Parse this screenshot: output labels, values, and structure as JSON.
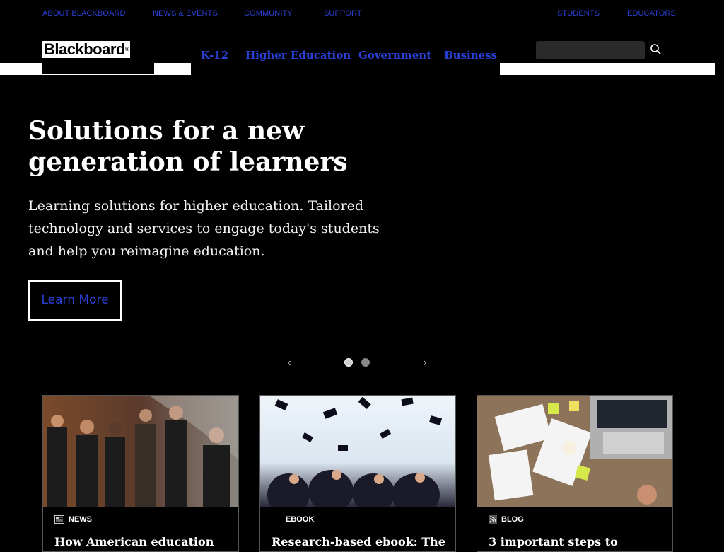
{
  "top_links": [
    {
      "label": "ABOUT BLACKBOARD"
    },
    {
      "label": "NEWS & EVENTS"
    },
    {
      "label": "COMMUNITY"
    },
    {
      "label": "SUPPORT"
    },
    {
      "label": "STUDENTS"
    },
    {
      "label": "EDUCATORS"
    }
  ],
  "logo": {
    "text": "Blackboard",
    "mark": "®"
  },
  "main_nav": [
    {
      "label": "K-12"
    },
    {
      "label": "Higher Education"
    },
    {
      "label": "Government"
    },
    {
      "label": "Business"
    }
  ],
  "search": {
    "icon": "search-icon"
  },
  "hero": {
    "title_line1": "Solutions for a new",
    "title_line2": "generation of learners",
    "description": "Learning solutions for higher education. Tailored technology and services to engage today's students and help you reimagine education.",
    "button_label": "Learn More"
  },
  "carousel": {
    "prev": "‹",
    "next": "›",
    "slide_count": 2,
    "active_index": 0
  },
  "cards": [
    {
      "category": "NEWS",
      "category_icon": "news-icon",
      "title": "How American education"
    },
    {
      "category": "EBOOK",
      "category_icon": "",
      "title": "Research-based ebook: The"
    },
    {
      "category": "BLOG",
      "category_icon": "rss-icon",
      "title": "3 important steps to"
    }
  ],
  "colors": {
    "link": "#2b40d6",
    "background": "#000000",
    "text": "#ffffff"
  }
}
